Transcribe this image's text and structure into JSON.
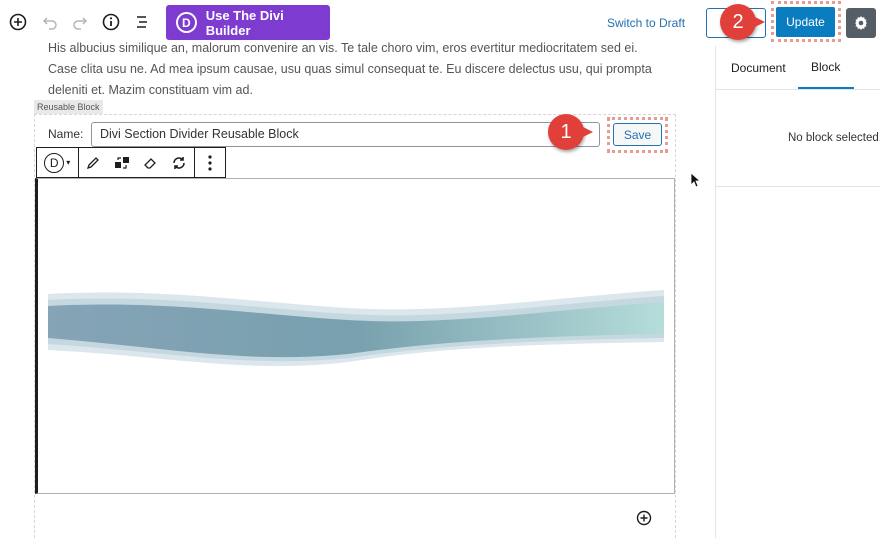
{
  "toolbar": {
    "add_icon": "plus-circle-icon",
    "undo_icon": "undo-icon",
    "redo_icon": "redo-icon",
    "info_icon": "info-icon",
    "outline_icon": "list-icon",
    "divi_logo_letter": "D",
    "divi_button_label": "Use The Divi Builder",
    "switch_draft_label": "Switch to Draft",
    "update_label": "Update",
    "settings_icon": "gear-icon"
  },
  "callouts": {
    "one": "1",
    "two": "2"
  },
  "editor": {
    "para_line1": "His albucius similique an, malorum convenire an vis. Te tale choro vim, eros evertitur mediocritatem sed ei.",
    "para_line2": "Case clita usu ne. Ad mea ipsum causae, usu quas simul consequat te. Eu discere delectus usu, qui prompta",
    "para_line3": "deleniti et. Mazim constituam vim ad.",
    "reusable_label": "Reusable Block",
    "name_label": "Name:",
    "name_value": "Divi Section Divider Reusable Block",
    "save_label": "Save",
    "block_toolbar": {
      "divi_letter": "D"
    }
  },
  "sidebar": {
    "tabs": [
      {
        "label": "Document"
      },
      {
        "label": "Block"
      }
    ],
    "active_tab": "Block",
    "empty_message": "No block selected."
  },
  "colors": {
    "accent": "#0a7cc0",
    "divi_purple": "#7e3bd0",
    "callout_red": "#e1403a",
    "highlight_dots": "#e79b94"
  }
}
